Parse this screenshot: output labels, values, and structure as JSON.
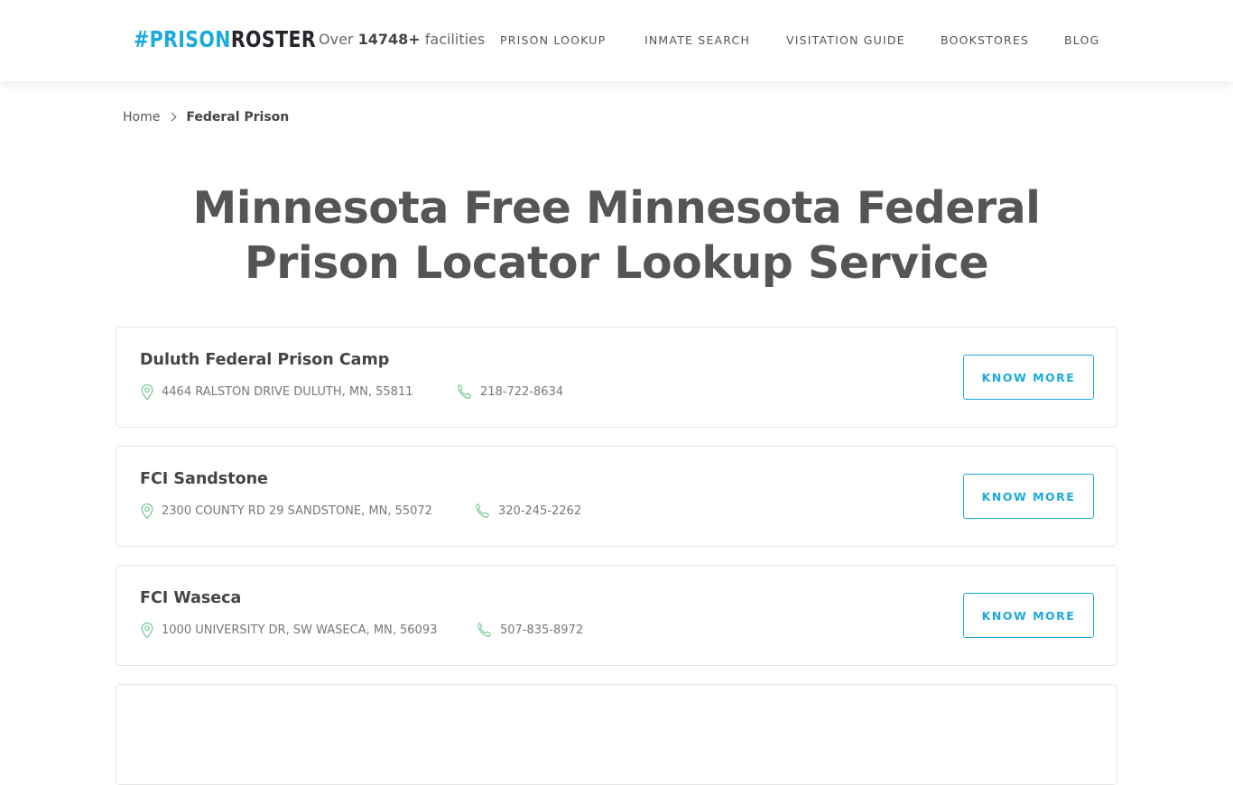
{
  "header": {
    "logo": {
      "hash_part": "#PRISON",
      "second_part": "ROSTER"
    },
    "facilities": {
      "prefix": "Over",
      "count": "14748+",
      "suffix": "facilities"
    },
    "nav": [
      {
        "label": "PRISON LOOKUP"
      },
      {
        "label": "INMATE SEARCH"
      },
      {
        "label": "VISITATION GUIDE"
      },
      {
        "label": "BOOKSTORES"
      },
      {
        "label": "BLOG"
      }
    ]
  },
  "breadcrumb": {
    "home": "Home",
    "current": "Federal Prison"
  },
  "page": {
    "title_line1": "Minnesota Free Minnesota Federal",
    "title_line2": "Prison Locator Lookup Service"
  },
  "facilities": [
    {
      "name": "Duluth Federal Prison Camp",
      "address": "4464 RALSTON DRIVE DULUTH, MN, 55811",
      "phone": "218-722-8634",
      "button": "KNOW MORE"
    },
    {
      "name": "FCI Sandstone",
      "address": "2300 COUNTY RD 29 SANDSTONE, MN, 55072",
      "phone": "320-245-2262",
      "button": "KNOW MORE"
    },
    {
      "name": "FCI Waseca",
      "address": "1000 UNIVERSITY DR, SW WASECA, MN, 56093",
      "phone": "507-835-8972",
      "button": "KNOW MORE"
    }
  ],
  "colors": {
    "brand_blue": "#1ba9de",
    "icon_green": "#7ec99a",
    "text": "#555555"
  }
}
